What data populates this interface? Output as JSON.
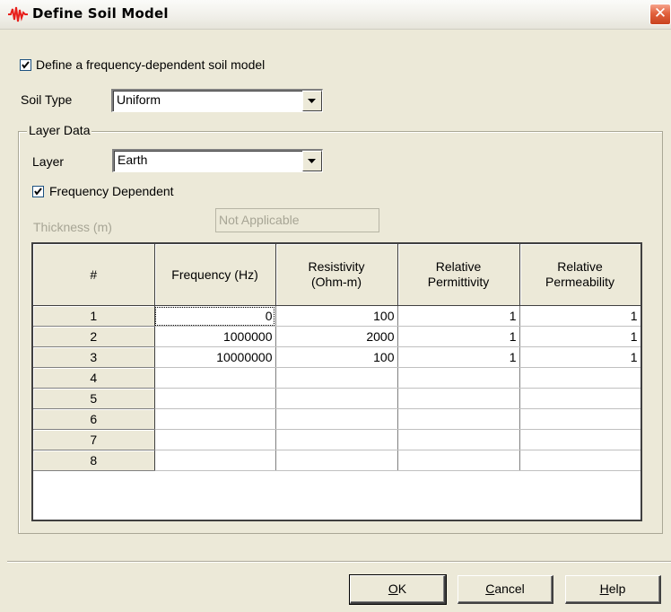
{
  "window": {
    "title": "Define Soil Model",
    "close_glyph": "✕"
  },
  "freq_model_checkbox": {
    "label": "Define a frequency-dependent soil model",
    "checked": true
  },
  "soil_type": {
    "label": "Soil Type",
    "value": "Uniform"
  },
  "layer_data": {
    "group_label": "Layer Data",
    "layer_label": "Layer",
    "layer_value": "Earth",
    "freq_dependent_label": "Frequency Dependent",
    "freq_dependent_checked": true,
    "thickness_label": "Thickness (m)",
    "thickness_value": "Not Applicable"
  },
  "grid": {
    "headers": [
      "#",
      "Frequency (Hz)",
      "Resistivity\n(Ohm-m)",
      "Relative\nPermittivity",
      "Relative\nPermeability"
    ],
    "rows": [
      [
        "1",
        "0",
        "100",
        "1",
        "1"
      ],
      [
        "2",
        "1000000",
        "2000",
        "1",
        "1"
      ],
      [
        "3",
        "10000000",
        "100",
        "1",
        "1"
      ],
      [
        "4",
        "",
        "",
        "",
        ""
      ],
      [
        "5",
        "",
        "",
        "",
        ""
      ],
      [
        "6",
        "",
        "",
        "",
        ""
      ],
      [
        "7",
        "",
        "",
        "",
        ""
      ],
      [
        "8",
        "",
        "",
        "",
        ""
      ]
    ]
  },
  "buttons": {
    "ok": {
      "mnemonic": "O",
      "rest": "K"
    },
    "cancel": {
      "mnemonic": "C",
      "rest": "ancel"
    },
    "help": {
      "mnemonic": "H",
      "rest": "elp"
    }
  },
  "colors": {
    "dialog_bg": "#ece9d8",
    "title_icon": "#e8201b",
    "close_button": "#e2623e"
  }
}
